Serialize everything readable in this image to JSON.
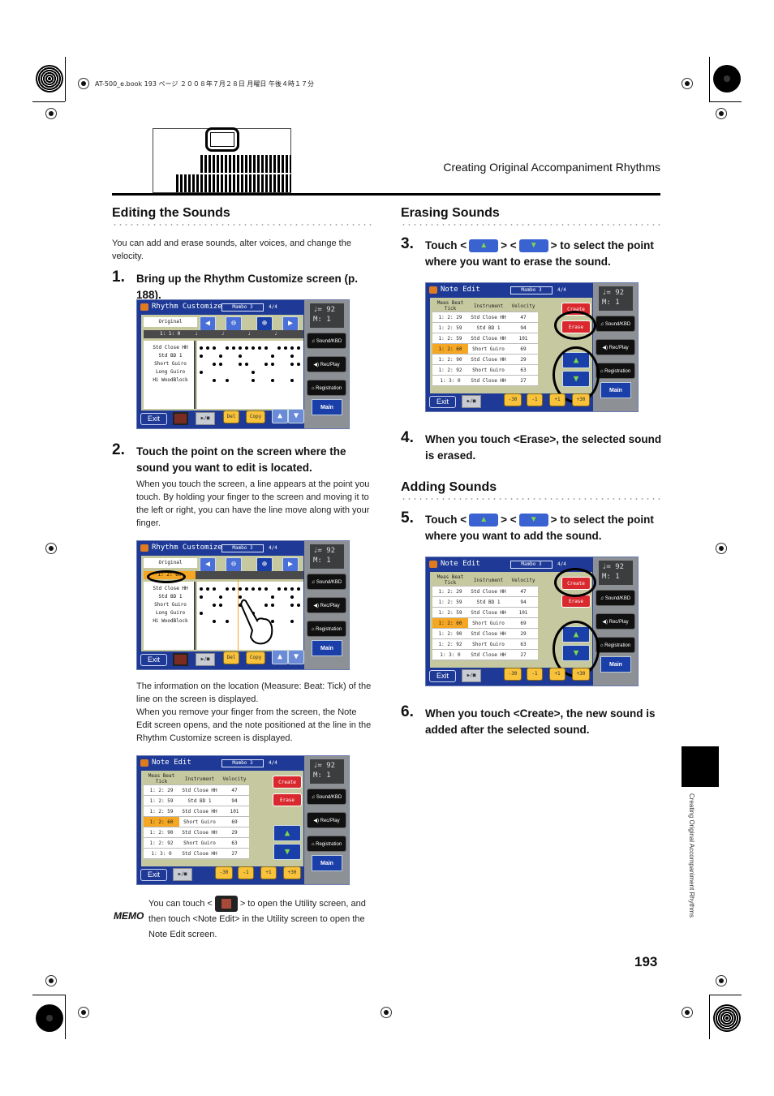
{
  "print_header": "AT-500_e.book  193 ページ  ２００８年７月２８日  月曜日  午後４時１７分",
  "section_header": "Creating Original Accompaniment Rhythms",
  "side_tab_text": "Creating Original Accompaniment Rhythms",
  "page_number": "193",
  "left": {
    "heading": "Editing the Sounds",
    "intro": "You can add and erase sounds, alter voices, and change the velocity.",
    "step1": {
      "num": "1.",
      "text": "Bring up the Rhythm Customize screen (p. 188)."
    },
    "step2": {
      "num": "2.",
      "text": "Touch the point on the screen where the sound you want to edit is located.",
      "detail": "When you touch the screen, a line appears at the point you touch. By holding your finger to the screen and moving it to the left or right, you can have the line move along with your finger."
    },
    "after_screen2": "The information on the location (Measure: Beat: Tick) of the line on the screen is displayed.",
    "after_screen2b": "When you remove your finger from the screen, the Note Edit screen opens, and the note positioned at the line in the Rhythm Customize screen is displayed.",
    "memo_label": "MEMO",
    "memo_text_a": "You can touch <",
    "memo_text_b": "> to open the Utility screen, and then touch <Note Edit> in the Utility screen to open the Note Edit screen."
  },
  "right": {
    "heading_erase": "Erasing Sounds",
    "step3": {
      "num": "3.",
      "pre": "Touch <",
      "mid": "> <",
      "post": "> to select the point where you want to erase the sound."
    },
    "step4": {
      "num": "4.",
      "text": "When you touch <Erase>, the selected sound is erased."
    },
    "heading_add": "Adding Sounds",
    "step5": {
      "num": "5.",
      "pre": "Touch <",
      "mid": "> <",
      "post": "> to select the point where you want to add the sound."
    },
    "step6": {
      "num": "6.",
      "text": "When you touch <Create>, the new sound is added after the selected sound."
    }
  },
  "screen_common": {
    "rhythm": "Mambo 3",
    "meter": "4/4",
    "tempo": "♩= 92",
    "measure": "M:   1",
    "side_buttons": [
      "♫ Sound/KBD",
      "◀) Rec/Play",
      "⌂ Registration"
    ],
    "main": "Main",
    "exit": "Exit",
    "play": "▶/■",
    "up": "▲",
    "down": "▼"
  },
  "rhythm_customize": {
    "title": "Rhythm Customize",
    "original": "Original",
    "position_1": "1: 1:  0",
    "position_2": "1: 2: 60",
    "del": "Del",
    "copy": "Copy",
    "instruments": [
      "Std Close HH",
      "Std BD 1",
      "Short Guiro",
      "Long Guiro",
      "Hi WoodBlock"
    ]
  },
  "note_edit": {
    "title": "Note Edit",
    "headers": [
      "Meas Beat Tick",
      "Instrument",
      "Velocity"
    ],
    "rows": [
      [
        "1: 2: 29",
        "Std Close HH",
        "47"
      ],
      [
        "1: 2: 59",
        "Std BD 1",
        "94"
      ],
      [
        "1: 2: 59",
        "Std Close HH",
        "101"
      ],
      [
        "1: 2: 60",
        "Short Guiro",
        "69"
      ],
      [
        "1: 2: 90",
        "Std Close HH",
        "29"
      ],
      [
        "1: 2: 92",
        "Short Guiro",
        "63"
      ],
      [
        "1: 3:  0",
        "Std Close HH",
        "27"
      ]
    ],
    "create": "Create",
    "erase": "Erase",
    "value_buttons": [
      "-30",
      "-1",
      "+1",
      "+30"
    ]
  }
}
